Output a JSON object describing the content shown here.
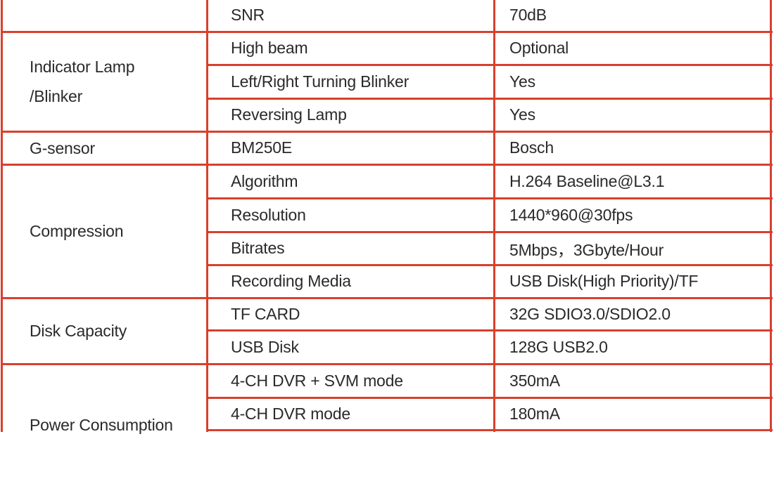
{
  "table": {
    "groups": [
      {
        "category": "",
        "rows": [
          {
            "parameter": "SNR",
            "value": "70dB"
          }
        ]
      },
      {
        "category": "Indicator Lamp\n/Blinker",
        "rows": [
          {
            "parameter": "High beam",
            "value": "Optional"
          },
          {
            "parameter": "Left/Right Turning Blinker",
            "value": "Yes"
          },
          {
            "parameter": "Reversing Lamp",
            "value": "Yes"
          }
        ]
      },
      {
        "category": "G-sensor",
        "rows": [
          {
            "parameter": "BM250E",
            "value": "Bosch"
          }
        ]
      },
      {
        "category": "Compression",
        "rows": [
          {
            "parameter": "Algorithm",
            "value": "H.264 Baseline@L3.1"
          },
          {
            "parameter": "Resolution",
            "value": "1440*960@30fps"
          },
          {
            "parameter": "Bitrates",
            "value": "5Mbps，3Gbyte/Hour"
          },
          {
            "parameter": "Recording Media",
            "value": "USB Disk(High Priority)/TF"
          }
        ]
      },
      {
        "category": "Disk Capacity",
        "rows": [
          {
            "parameter": "TF CARD",
            "value": "32G SDIO3.0/SDIO2.0"
          },
          {
            "parameter": "USB Disk",
            "value": "128G USB2.0"
          }
        ]
      },
      {
        "category": "Power Consumption",
        "rows": [
          {
            "parameter": "4-CH DVR + SVM mode",
            "value": "350mA"
          },
          {
            "parameter": "4-CH DVR mode",
            "value": "180mA"
          }
        ]
      }
    ],
    "colors": {
      "border": "#d8402c",
      "text": "#2a2a2a"
    }
  }
}
